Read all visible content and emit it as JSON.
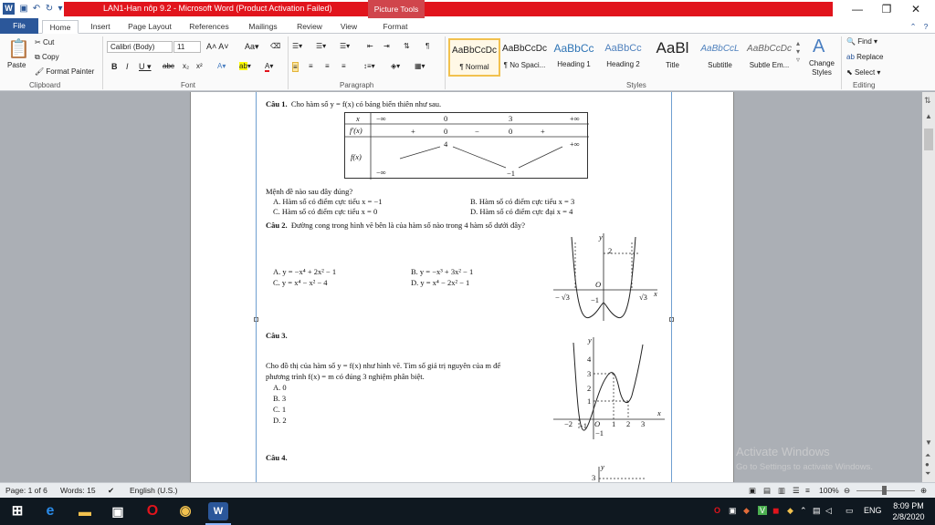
{
  "window": {
    "title": "LAN1-Han nôp 9.2 - Microsoft Word (Product Activation Failed)",
    "context_tab": "Picture Tools"
  },
  "tabs": [
    "File",
    "Home",
    "Insert",
    "Page Layout",
    "References",
    "Mailings",
    "Review",
    "View",
    "Format"
  ],
  "ribbon": {
    "clipboard": {
      "paste": "Paste",
      "cut": "Cut",
      "copy": "Copy",
      "format_painter": "Format Painter",
      "label": "Clipboard"
    },
    "font": {
      "family": "Calibri (Body)",
      "size": "11",
      "label": "Font"
    },
    "paragraph": {
      "label": "Paragraph"
    },
    "styles": {
      "label": "Styles",
      "items": [
        {
          "sample": "AaBbCcDc",
          "name": "¶ Normal"
        },
        {
          "sample": "AaBbCcDc",
          "name": "¶ No Spaci..."
        },
        {
          "sample": "AaBbCc",
          "name": "Heading 1"
        },
        {
          "sample": "AaBbCc",
          "name": "Heading 2"
        },
        {
          "sample": "AaBl",
          "name": "Title"
        },
        {
          "sample": "AaBbCcL",
          "name": "Subtitle"
        },
        {
          "sample": "AaBbCcDc",
          "name": "Subtle Em..."
        }
      ],
      "change_styles": "Change Styles"
    },
    "editing": {
      "find": "Find",
      "replace": "Replace",
      "select": "Select",
      "label": "Editing"
    }
  },
  "document": {
    "q1": {
      "label": "Câu 1.",
      "text": "Cho hàm số y = f(x) có bảng biến thiên như sau.",
      "table": {
        "x_row": [
          "x",
          "−∞",
          "0",
          "3",
          "+∞"
        ],
        "fprime_row": [
          "f′(x)",
          "+",
          "0",
          "−",
          "0",
          "+"
        ],
        "f_label": "f(x)",
        "f_values": [
          "−∞",
          "4",
          "−1",
          "+∞"
        ]
      },
      "prompt": "Mệnh đề nào sau đây đúng?",
      "A": "A. Hàm số có điểm cực tiểu x = −1",
      "B": "B. Hàm số có điểm cực tiểu x = 3",
      "C": "C. Hàm số có điểm cực tiểu x = 0",
      "D": "D. Hàm số có điểm cực đại x = 4"
    },
    "q2": {
      "label": "Câu 2.",
      "text": "Đường cong trong hình vẽ bên là của hàm số nào trong 4 hàm số dưới đây?",
      "A": "A. y = −x⁴ + 2x² − 1",
      "B": "B. y = −x³ + 3x² − 1",
      "C": "C. y = x⁴ − x² − 4",
      "D": "D. y = x⁴ − 2x² − 1",
      "graph_labels": {
        "y": "y",
        "two": "2",
        "o": "O",
        "x": "x",
        "neg_sqrt3": "− √3",
        "neg1": "−1",
        "sqrt3": "√3"
      }
    },
    "q3": {
      "label": "Câu 3.",
      "text1": "Cho đồ thị của hàm số y = f(x) như hình vẽ. Tìm số giá trị nguyên của m để",
      "text2": "phương trình f(x) = m có đúng 3 nghiệm phân biệt.",
      "A": "A. 0",
      "B": "B. 3",
      "C": "C. 1",
      "D": "D. 2",
      "graph_labels": {
        "y": "y",
        "4": "4",
        "3": "3",
        "2": "2",
        "1": "1",
        "x": "x",
        "neg2": "−2",
        "neg1": "−1",
        "o": "O",
        "one": "1",
        "two": "2",
        "three": "3",
        "ny": "−1"
      }
    },
    "q4": {
      "label": "Câu 4.",
      "graph_labels": {
        "y": "y",
        "3": "3"
      }
    }
  },
  "watermark": {
    "line1": "Activate Windows",
    "line2": "Go to Settings to activate Windows."
  },
  "status": {
    "page": "Page: 1 of 6",
    "words": "Words: 15",
    "language": "English (U.S.)",
    "zoom": "100%"
  },
  "taskbar": {
    "time": "8:09 PM",
    "date": "2/8/2020",
    "lang": "ENG"
  }
}
